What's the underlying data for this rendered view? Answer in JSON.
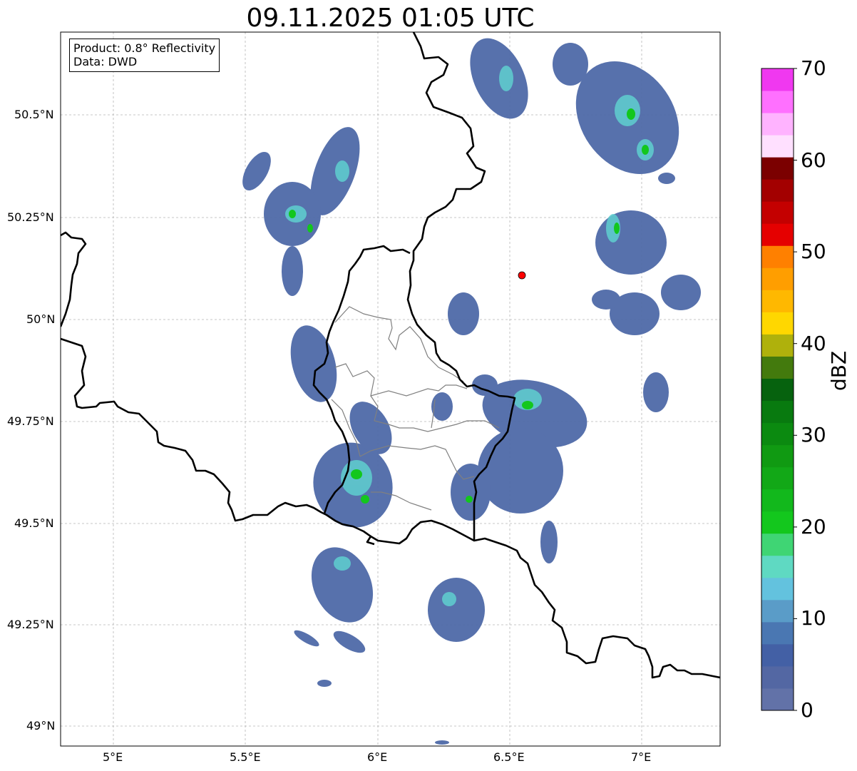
{
  "title": "09.11.2025 01:05 UTC",
  "info": {
    "product": "Product: 0.8° Reflectivity",
    "data": "Data: DWD"
  },
  "map": {
    "lon_range": [
      4.8,
      7.3
    ],
    "lat_range": [
      48.95,
      50.7
    ],
    "lon_ticks": [
      "5°E",
      "5.5°E",
      "6°E",
      "6.5°E",
      "7°E"
    ],
    "lat_ticks": [
      "50.5°N",
      "50.25°N",
      "50°N",
      "49.75°N",
      "49.5°N",
      "49.25°N",
      "49°N"
    ],
    "gridlines": true,
    "radar_site_color": "#ff0000"
  },
  "colorbar": {
    "label": "dBZ",
    "range": [
      0,
      70
    ],
    "ticks": [
      "70",
      "60",
      "50",
      "40",
      "30",
      "20",
      "10",
      "0"
    ],
    "colors_bottom_to_top": [
      "#6272a8",
      "#5367a3",
      "#4360a5",
      "#4a77b2",
      "#5a9cc8",
      "#63c2de",
      "#5fd9c2",
      "#3fd574",
      "#13c71d",
      "#12b81c",
      "#12a817",
      "#109a12",
      "#0b8a10",
      "#087a0f",
      "#06620e",
      "#437a0d",
      "#afb10c",
      "#ffd700",
      "#ffb800",
      "#ff9e00",
      "#ff8000",
      "#e50000",
      "#c40000",
      "#a30000",
      "#7b0000",
      "#ffe0ff",
      "#ffb3ff",
      "#ff70ff",
      "#f038f0"
    ]
  }
}
